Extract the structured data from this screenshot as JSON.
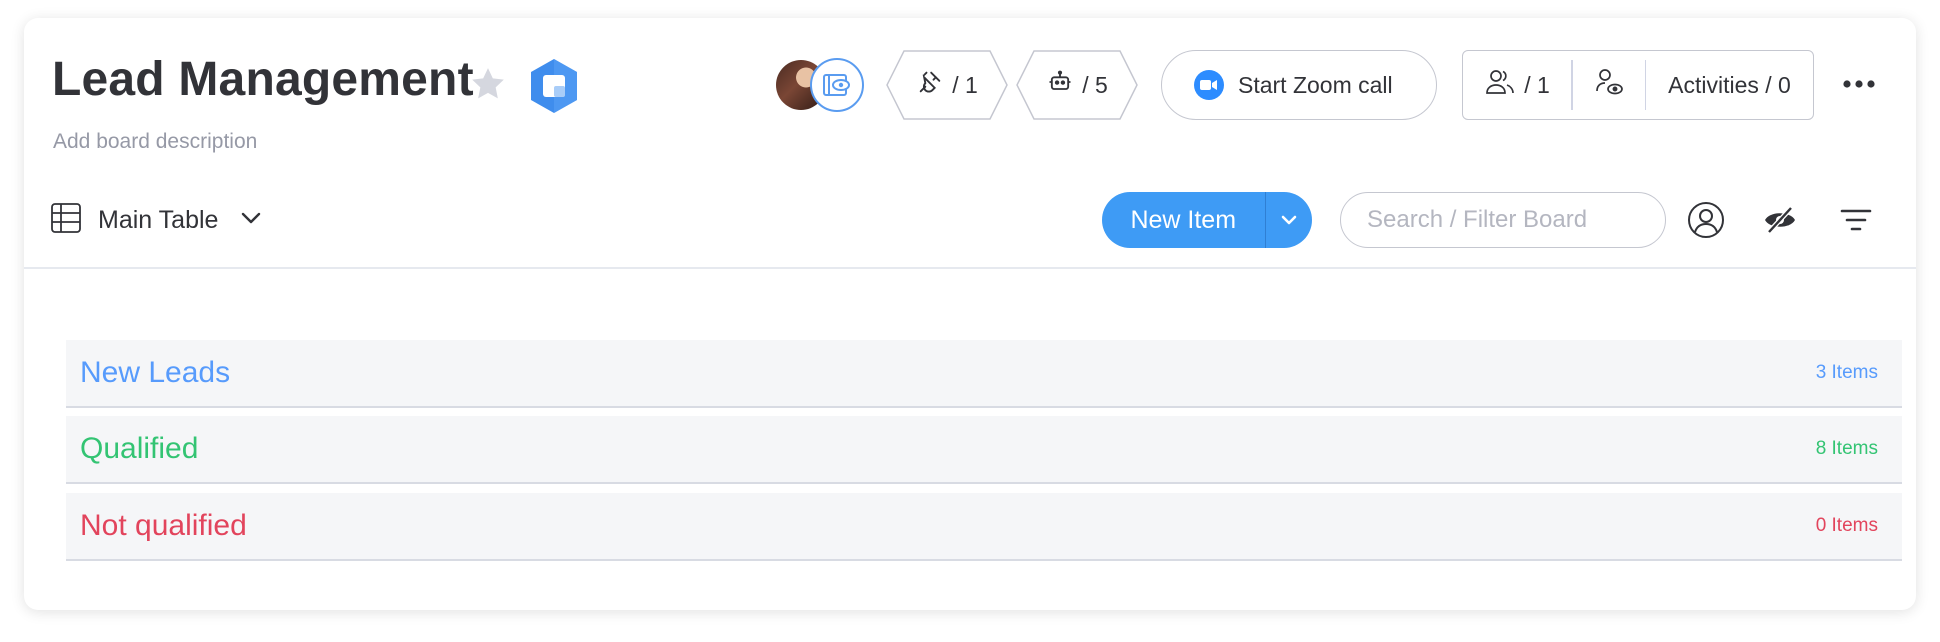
{
  "board": {
    "title": "Lead Management",
    "description": "Add board description"
  },
  "header": {
    "integrations_count": "/ 1",
    "automations_count": "/ 5",
    "zoom_label": "Start Zoom call",
    "members_count": "/ 1",
    "activities_label": "Activities / 0"
  },
  "toolbar": {
    "view_label": "Main Table",
    "new_item_label": "New Item",
    "search_placeholder": "Search / Filter Board"
  },
  "groups": [
    {
      "title": "New Leads",
      "count": "3 Items",
      "color": "#579bfc"
    },
    {
      "title": "Qualified",
      "count": "8 Items",
      "color": "#33c473"
    },
    {
      "title": "Not qualified",
      "count": "0 Items",
      "color": "#e2445c"
    }
  ],
  "colors": {
    "primary": "#3e9bf5",
    "zoom": "#2d8cff",
    "text": "#323338",
    "muted": "#9699a6"
  },
  "icons": [
    "star-icon",
    "board-logo-icon",
    "viewer-eye-icon",
    "integrations-plug-icon",
    "automations-robot-icon",
    "zoom-camera-icon",
    "members-icon",
    "guest-access-icon",
    "more-options-icon",
    "table-view-icon",
    "chevron-down-icon",
    "person-filter-icon",
    "hide-columns-icon",
    "sort-filter-icon"
  ]
}
